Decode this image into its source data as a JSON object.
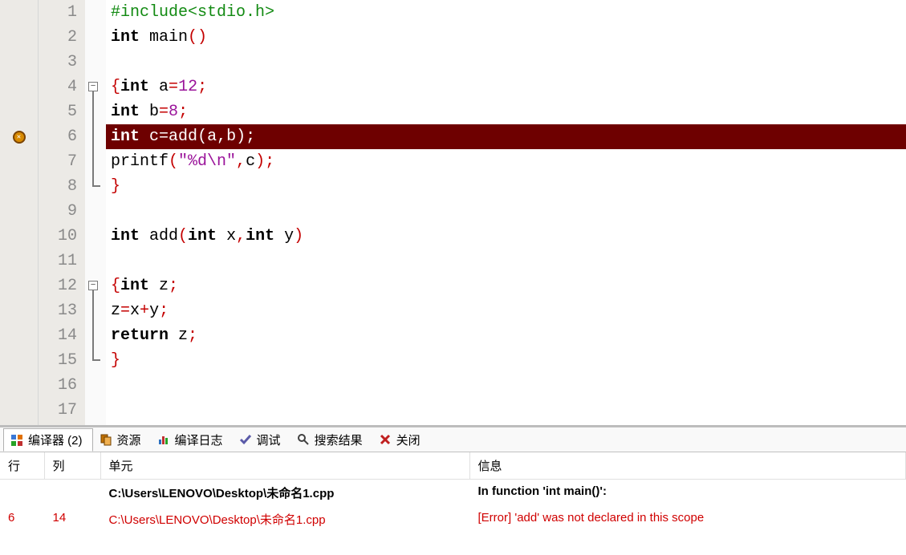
{
  "editor": {
    "lines": [
      {
        "n": 1,
        "tokens": [
          {
            "t": "#include<stdio.h>",
            "c": "pp"
          }
        ]
      },
      {
        "n": 2,
        "tokens": [
          {
            "t": "int",
            "c": "kw"
          },
          {
            "t": " main"
          },
          {
            "t": "()",
            "c": "punc"
          }
        ]
      },
      {
        "n": 3,
        "tokens": []
      },
      {
        "n": 4,
        "fold": "open",
        "tokens": [
          {
            "t": "{",
            "c": "punc"
          },
          {
            "t": "int",
            "c": "kw"
          },
          {
            "t": " a"
          },
          {
            "t": "=",
            "c": "punc"
          },
          {
            "t": "12",
            "c": "num"
          },
          {
            "t": ";",
            "c": "punc"
          }
        ]
      },
      {
        "n": 5,
        "fold": "mid",
        "tokens": [
          {
            "t": "int",
            "c": "kw"
          },
          {
            "t": " b"
          },
          {
            "t": "=",
            "c": "punc"
          },
          {
            "t": "8",
            "c": "num"
          },
          {
            "t": ";",
            "c": "punc"
          }
        ]
      },
      {
        "n": 6,
        "fold": "mid",
        "bp": true,
        "hl": true,
        "tokens": [
          {
            "t": "int",
            "c": "kw"
          },
          {
            "t": " c"
          },
          {
            "t": "=",
            "c": "punc"
          },
          {
            "t": "add"
          },
          {
            "t": "(",
            "c": "punc"
          },
          {
            "t": "a"
          },
          {
            "t": ",",
            "c": "punc"
          },
          {
            "t": "b"
          },
          {
            "t": ");",
            "c": "punc"
          }
        ]
      },
      {
        "n": 7,
        "fold": "mid",
        "tokens": [
          {
            "t": "printf"
          },
          {
            "t": "(",
            "c": "punc"
          },
          {
            "t": "\"%d\\n\"",
            "c": "str"
          },
          {
            "t": ",",
            "c": "punc"
          },
          {
            "t": "c"
          },
          {
            "t": ");",
            "c": "punc"
          }
        ]
      },
      {
        "n": 8,
        "fold": "end",
        "tokens": [
          {
            "t": "}",
            "c": "punc"
          }
        ]
      },
      {
        "n": 9,
        "tokens": []
      },
      {
        "n": 10,
        "tokens": [
          {
            "t": "int",
            "c": "kw"
          },
          {
            "t": " add"
          },
          {
            "t": "(",
            "c": "punc"
          },
          {
            "t": "int",
            "c": "kw"
          },
          {
            "t": " x"
          },
          {
            "t": ",",
            "c": "punc"
          },
          {
            "t": "int",
            "c": "kw"
          },
          {
            "t": " y"
          },
          {
            "t": ")",
            "c": "punc"
          }
        ]
      },
      {
        "n": 11,
        "tokens": []
      },
      {
        "n": 12,
        "fold": "open",
        "tokens": [
          {
            "t": "{",
            "c": "punc"
          },
          {
            "t": "int",
            "c": "kw"
          },
          {
            "t": " z"
          },
          {
            "t": ";",
            "c": "punc"
          }
        ]
      },
      {
        "n": 13,
        "fold": "mid",
        "tokens": [
          {
            "t": "z"
          },
          {
            "t": "=",
            "c": "punc"
          },
          {
            "t": "x"
          },
          {
            "t": "+",
            "c": "punc"
          },
          {
            "t": "y"
          },
          {
            "t": ";",
            "c": "punc"
          }
        ]
      },
      {
        "n": 14,
        "fold": "mid",
        "tokens": [
          {
            "t": "return",
            "c": "kw"
          },
          {
            "t": " z"
          },
          {
            "t": ";",
            "c": "punc"
          }
        ]
      },
      {
        "n": 15,
        "fold": "end",
        "tokens": [
          {
            "t": "}",
            "c": "punc"
          }
        ]
      },
      {
        "n": 16,
        "tokens": []
      },
      {
        "n": 17,
        "tokens": []
      }
    ]
  },
  "tabs": [
    {
      "id": "compiler",
      "label": "编译器 (2)",
      "active": true,
      "icon": "grid"
    },
    {
      "id": "resource",
      "label": "资源",
      "icon": "copy"
    },
    {
      "id": "compile-log",
      "label": "编译日志",
      "icon": "bars"
    },
    {
      "id": "debug",
      "label": "调试",
      "icon": "tick"
    },
    {
      "id": "search",
      "label": "搜索结果",
      "icon": "search"
    },
    {
      "id": "close",
      "label": "关闭",
      "icon": "close"
    }
  ],
  "ctable": {
    "headers": {
      "line": "行",
      "col": "列",
      "unit": "单元",
      "msg": "信息"
    },
    "rows": [
      {
        "kind": "header",
        "line": "",
        "col": "",
        "unit": "C:\\Users\\LENOVO\\Desktop\\未命名1.cpp",
        "msg": "In function 'int main()':"
      },
      {
        "kind": "error",
        "line": "6",
        "col": "14",
        "unit": "C:\\Users\\LENOVO\\Desktop\\未命名1.cpp",
        "msg": "[Error] 'add' was not declared in this scope"
      }
    ]
  }
}
